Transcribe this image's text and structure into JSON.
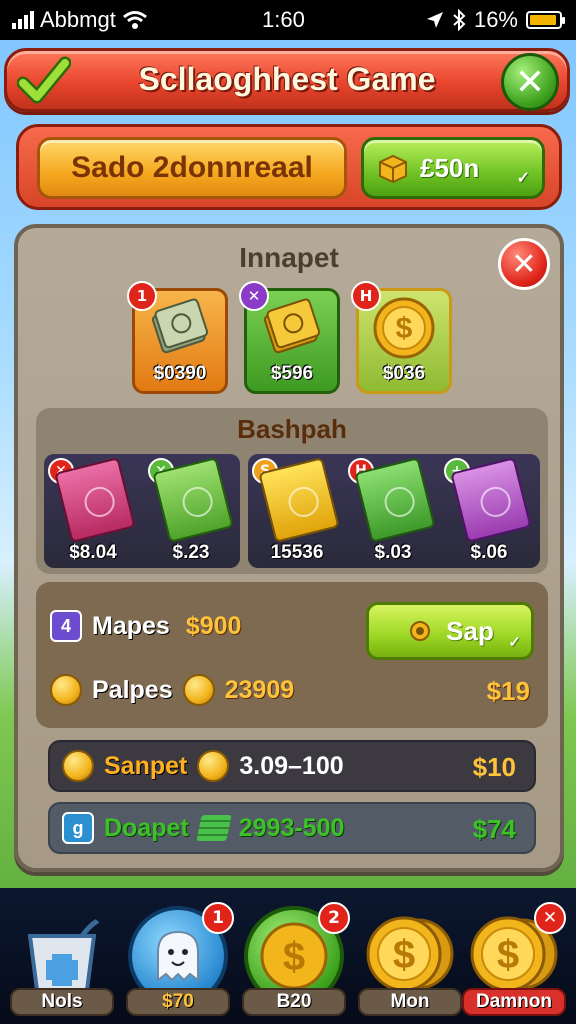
{
  "status_bar": {
    "carrier": "Abbmgt",
    "time": "1:60",
    "battery": "16%"
  },
  "header": {
    "title": "Scllaoghhest Game"
  },
  "banner": {
    "left_button": "Sado 2donnreaal",
    "right_button": "£50n"
  },
  "panel": {
    "title": "Innapet",
    "top_cards": [
      {
        "badge": "1",
        "price": "$0390",
        "color": "#f39a2a"
      },
      {
        "badge": "✕",
        "price": "$596",
        "color": "#58b93a"
      },
      {
        "badge": "H",
        "price": "$036",
        "color": "#b5d552"
      }
    ],
    "section_title": "Bashpah",
    "items": [
      {
        "badge": "✕",
        "price": "$8.04",
        "color": "#d4417e"
      },
      {
        "badge": "✕",
        "price": "$.23",
        "color": "#6fc842"
      },
      {
        "badge": "S",
        "price": "15536",
        "color": "#f1c31e"
      },
      {
        "badge": "H",
        "price": "$.03",
        "color": "#51b94a"
      },
      {
        "badge": "+",
        "price": "$.06",
        "color": "#b556c9"
      }
    ],
    "stats": {
      "row1_badge": "4",
      "row1_label": "Mapes",
      "row1_value": "$900",
      "action_button": "Sap",
      "row2_label": "Palpes",
      "row2_value": "23909",
      "row2_price": "$19"
    },
    "bar1": {
      "label": "Sanpet",
      "value": "3.09–100",
      "price": "$10"
    },
    "bar2": {
      "badge": "g",
      "label": "Doapet",
      "value": "2993-500",
      "price": "$74"
    }
  },
  "bottom_nav": [
    {
      "label": "Nols",
      "badge": ""
    },
    {
      "label": "$70",
      "badge": "1"
    },
    {
      "label": "B20",
      "badge": "2"
    },
    {
      "label": "Mon",
      "badge": ""
    },
    {
      "label": "Damnon",
      "badge": "✕"
    }
  ]
}
